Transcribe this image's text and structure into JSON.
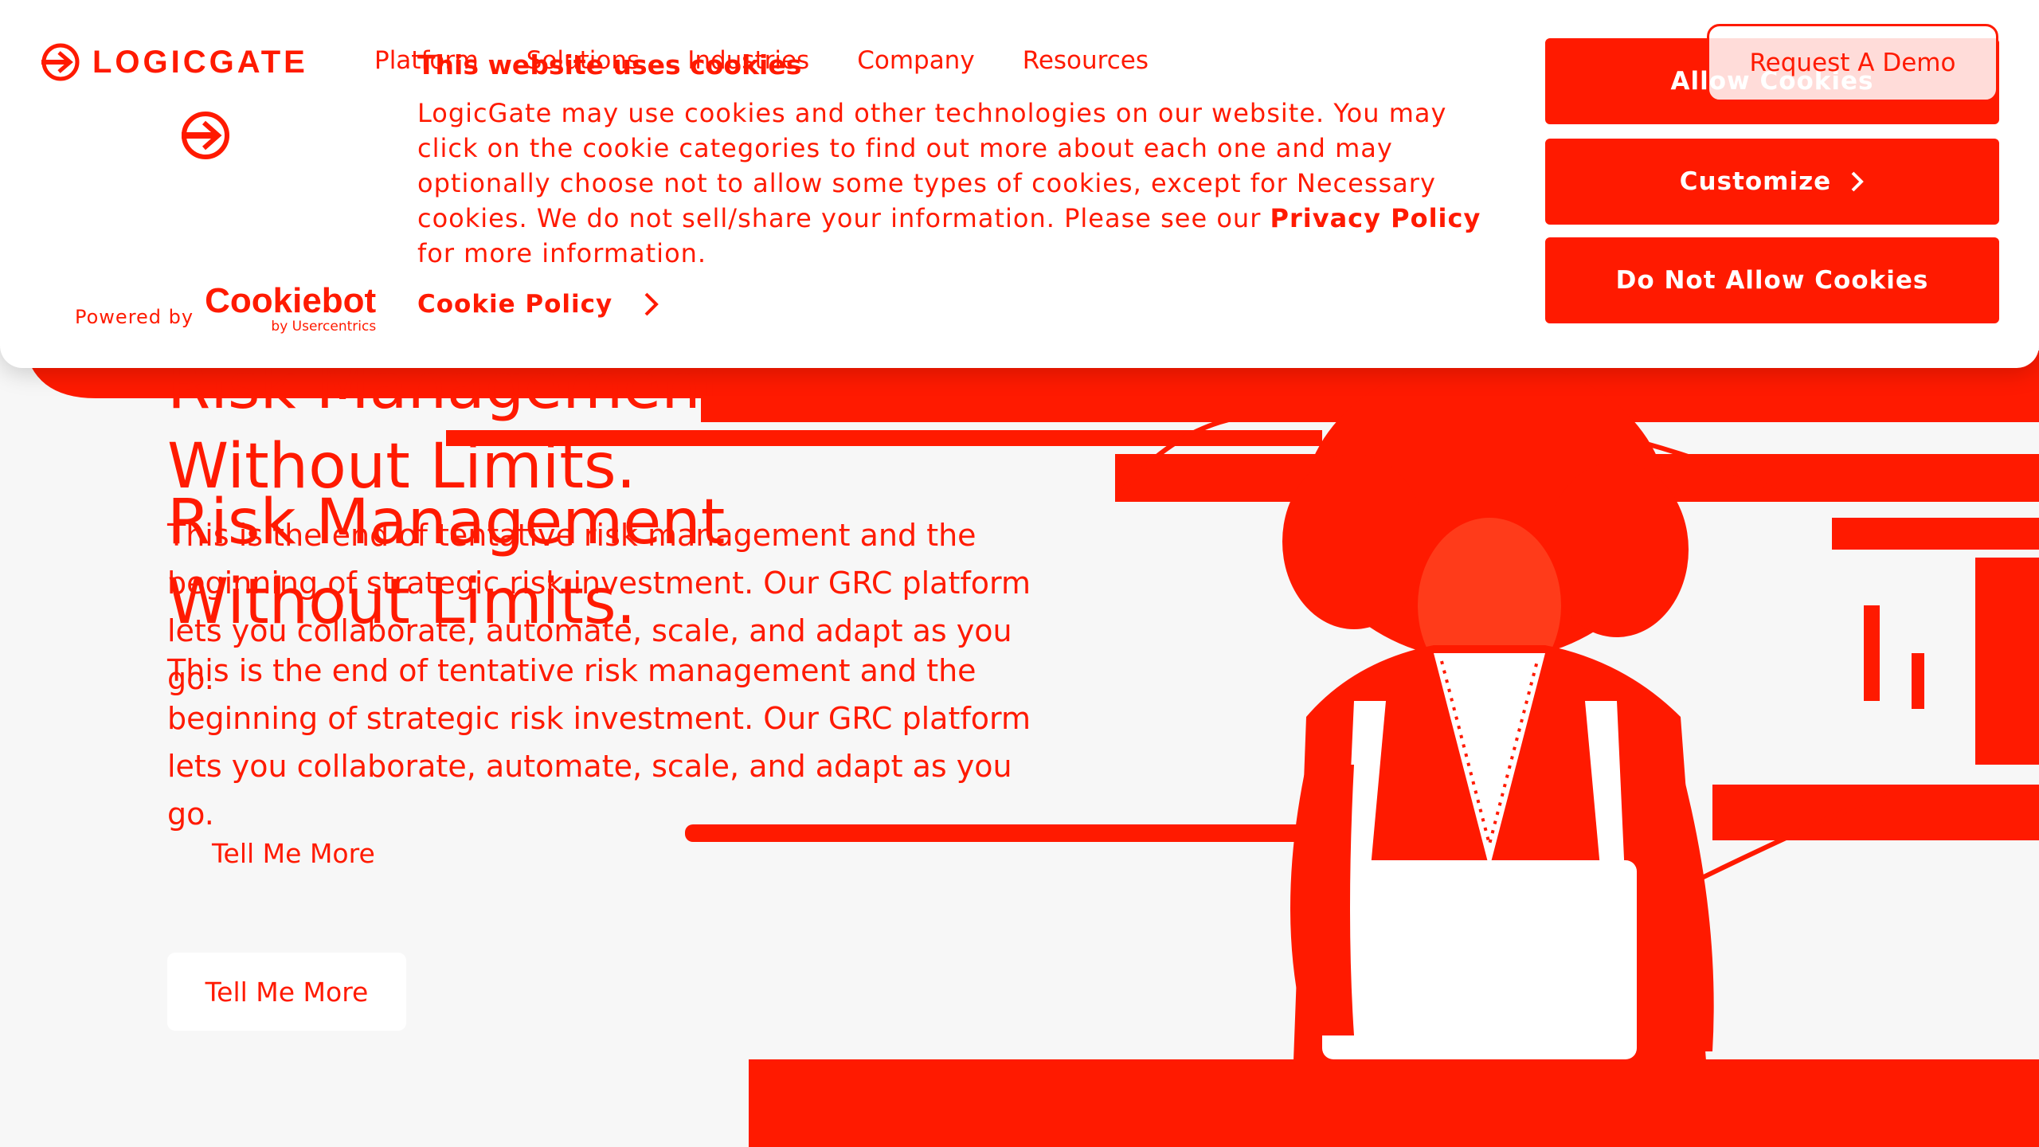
{
  "nav": {
    "brand": "LOGICGATE",
    "items": [
      "Platform",
      "Solutions",
      "Industries",
      "Company",
      "Resources"
    ],
    "demo_label": "Request A Demo"
  },
  "hero": {
    "title_line1": "Risk Management",
    "title_line2": "Without Limits.",
    "body": "This is the end of tentative risk management and the beginning of strategic risk investment. Our GRC platform lets you collaborate, automate, scale, and adapt as you go.",
    "cta_label": "Tell Me More"
  },
  "cookie_banner": {
    "title": "This website uses cookies",
    "body_before_link": "LogicGate may use cookies and other technologies on our website. You may click on the cookie categories to find out more about each one and may optionally choose not to allow some types of cookies, except for Necessary cookies.  We do not sell/share your information. Please see our ",
    "privacy_link": "Privacy Policy",
    "body_after_link": " for more information.",
    "powered_by": "Powered by",
    "brand_name": "Cookiebot",
    "brand_sub": "by Usercentrics",
    "policy_link": "Cookie Policy",
    "buttons": {
      "allow": "Allow Cookies",
      "customize": "Customize",
      "deny": "Do Not Allow Cookies"
    }
  },
  "colors": {
    "accent": "#ff1a00",
    "background": "#f7f7f7",
    "surface": "#ffffff"
  },
  "icons": [
    "logicgate-logo-icon",
    "chevron-right-icon"
  ]
}
